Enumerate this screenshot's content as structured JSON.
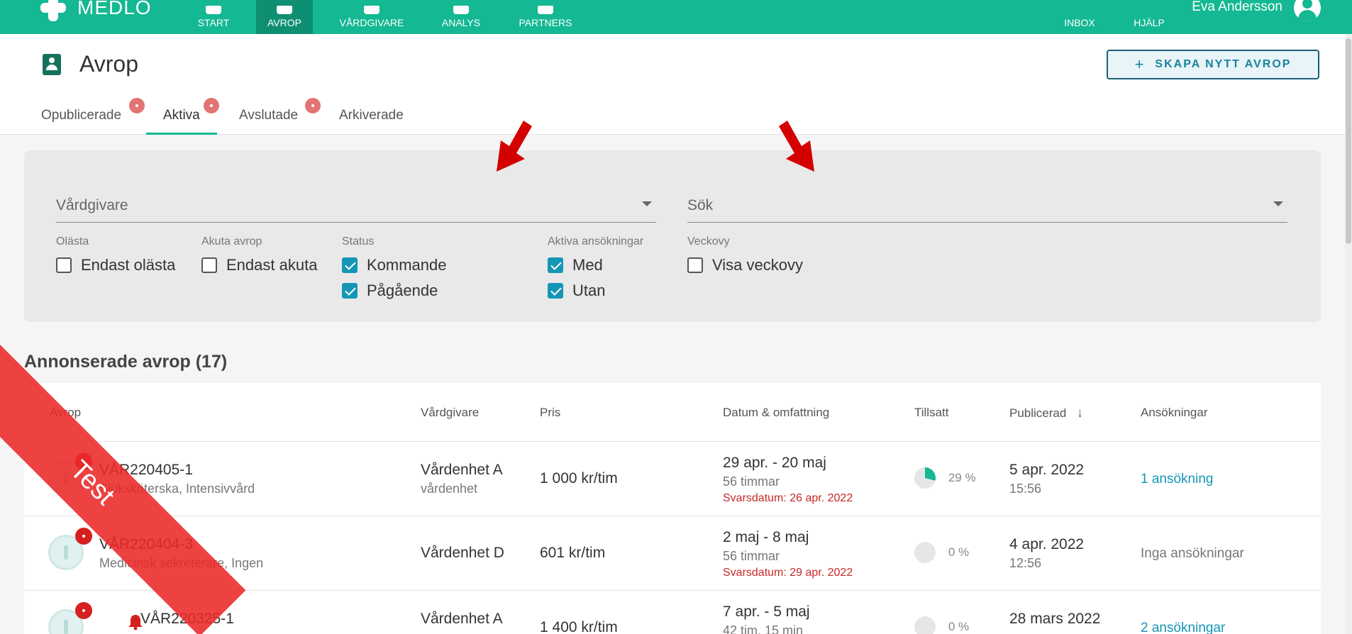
{
  "app": {
    "logo_text": "MEDLO",
    "brand_color": "#14b892",
    "user_name": "Eva Andersson"
  },
  "nav": {
    "items": [
      {
        "label": "START"
      },
      {
        "label": "AVROP"
      },
      {
        "label": "VÅRDGIVARE"
      },
      {
        "label": "ANALYS"
      },
      {
        "label": "PARTNERS"
      }
    ],
    "active": "AVROP",
    "right_items": [
      {
        "label": "INBOX"
      },
      {
        "label": "HJÄLP"
      }
    ]
  },
  "header": {
    "title": "Avrop",
    "create_button": "SKAPA NYTT AVROP",
    "tabs": [
      {
        "label": "Opublicerade",
        "badge": true
      },
      {
        "label": "Aktiva",
        "badge": true,
        "active": true
      },
      {
        "label": "Avslutade",
        "badge": true
      },
      {
        "label": "Arkiverade",
        "badge": false
      }
    ]
  },
  "filters": {
    "vardgivare_placeholder": "Vårdgivare",
    "sok_placeholder": "Sök",
    "groups": [
      {
        "label": "Olästa",
        "options": [
          {
            "label": "Endast olästa",
            "checked": false
          }
        ]
      },
      {
        "label": "Akuta avrop",
        "options": [
          {
            "label": "Endast akuta",
            "checked": false
          }
        ]
      },
      {
        "label": "Status",
        "options": [
          {
            "label": "Kommande",
            "checked": true
          },
          {
            "label": "Pågående",
            "checked": true
          }
        ]
      },
      {
        "label": "Aktiva ansökningar",
        "options": [
          {
            "label": "Med",
            "checked": true
          },
          {
            "label": "Utan",
            "checked": true
          }
        ]
      },
      {
        "label": "Veckovy",
        "options": [
          {
            "label": "Visa veckovy",
            "checked": false
          }
        ]
      }
    ]
  },
  "list": {
    "title": "Annonserade avrop (17)",
    "columns": [
      "Avrop",
      "Vårdgivare",
      "Pris",
      "Datum & omfattning",
      "Tillsatt",
      "Publicerad",
      "Ansökningar"
    ],
    "rows": [
      {
        "id": "VÅR220405-1",
        "role": "Sjuksköterska, Intensivvård",
        "provider": "Vårdenhet A",
        "provider_sub": "vårdenhet",
        "price": "1 000 kr/tim",
        "dates": "29 apr. - 20 maj",
        "scope": "56 timmar",
        "deadline": "Svarsdatum: 26 apr. 2022",
        "filled_pct": 29,
        "filled_label": "29 %",
        "published_date": "5 apr. 2022",
        "published_time": "15:56",
        "applications": "1 ansökning"
      },
      {
        "id": "VÅR220404-3",
        "role": "Medicinsk sekreterare, Ingen",
        "provider": "Vårdenhet D",
        "provider_sub": "",
        "price": "601 kr/tim",
        "dates": "2 maj - 8 maj",
        "scope": "56 timmar",
        "deadline": "Svarsdatum: 29 apr. 2022",
        "filled_pct": 0,
        "filled_label": "0 %",
        "published_date": "4 apr. 2022",
        "published_time": "12:56",
        "applications": "Inga ansökningar"
      },
      {
        "id": "VÅR220325-1",
        "role": "",
        "provider": "Vårdenhet A",
        "provider_sub": "",
        "price": "1 400 kr/tim",
        "dates": "7 apr. - 5 maj",
        "scope": "42 tim. 15 min",
        "deadline": "",
        "filled_pct": 0,
        "filled_label": "0 %",
        "published_date": "28 mars 2022",
        "published_time": "",
        "applications": "2 ansökningar"
      }
    ]
  },
  "ribbon": {
    "label": "Test"
  }
}
